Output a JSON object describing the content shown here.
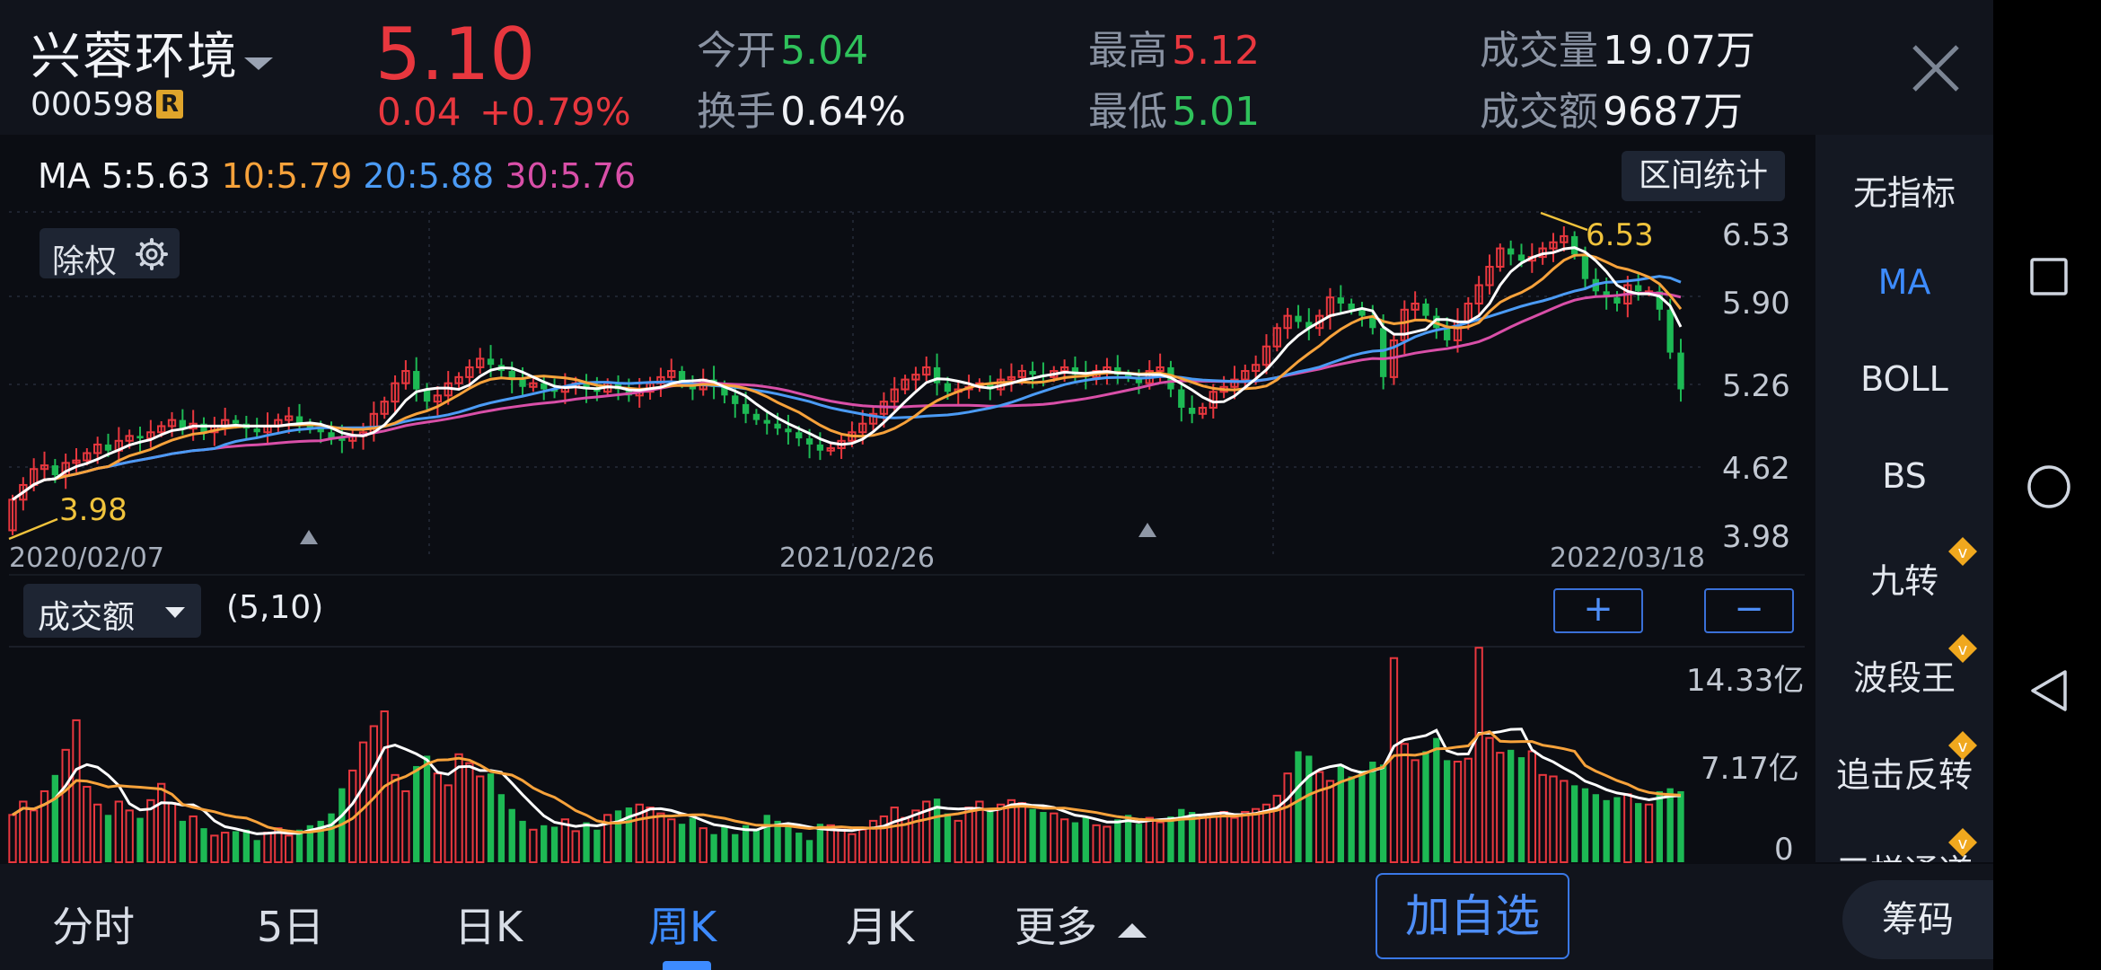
{
  "stock": {
    "name": "兴蓉环境",
    "code": "000598",
    "badge": "R",
    "price": "5.10",
    "change": "0.04",
    "change_pct": "+0.79%"
  },
  "quote": {
    "open": {
      "label": "今开",
      "value": "5.04"
    },
    "turnover": {
      "label": "换手",
      "value": "0.64%"
    },
    "high": {
      "label": "最高",
      "value": "5.12"
    },
    "low": {
      "label": "最低",
      "value": "5.01"
    },
    "volume": {
      "label": "成交量",
      "value": "19.07万"
    },
    "amount": {
      "label": "成交额",
      "value": "9687万"
    }
  },
  "ma_legend": {
    "title": "MA",
    "ma5": "5:5.63",
    "ma10": "10:5.79",
    "ma20": "20:5.88",
    "ma30": "30:5.76"
  },
  "toolbar": {
    "range_stats": "区间统计",
    "fq_label": "除权",
    "vol_select": "成交额",
    "vol_params": "(5,10)",
    "plus": "+",
    "minus": "−"
  },
  "side_menu": [
    {
      "label": "无指标",
      "active": false,
      "vip": false
    },
    {
      "label": "MA",
      "active": true,
      "vip": false
    },
    {
      "label": "BOLL",
      "active": false,
      "vip": false
    },
    {
      "label": "BS",
      "active": false,
      "vip": false
    },
    {
      "label": "九转",
      "active": false,
      "vip": true
    },
    {
      "label": "波段王",
      "active": false,
      "vip": true
    },
    {
      "label": "追击反转",
      "active": false,
      "vip": true
    },
    {
      "label": "三梯通道",
      "active": false,
      "vip": true
    }
  ],
  "bottom_tabs": [
    {
      "label": "分时",
      "active": false
    },
    {
      "label": "5日",
      "active": false
    },
    {
      "label": "日K",
      "active": false
    },
    {
      "label": "周K",
      "active": true
    },
    {
      "label": "月K",
      "active": false
    },
    {
      "label": "更多",
      "active": false
    }
  ],
  "actions": {
    "add_watchlist": "加自选",
    "chips": "筹码"
  },
  "colors": {
    "up": "#e8373e",
    "down": "#1db954",
    "ma5": "#ffffff",
    "ma10": "#f7a23b",
    "ma20": "#4b9bf5",
    "ma30": "#d94fa8",
    "accent": "#3d8bff"
  },
  "chart_data": {
    "type": "candlestick",
    "period": "weekly",
    "x_labels": [
      "2020/02/07",
      "2021/02/26",
      "2022/03/18"
    ],
    "price_axis_ticks": [
      "6.53",
      "5.90",
      "5.26",
      "4.62",
      "3.98"
    ],
    "ylim": [
      3.98,
      6.53
    ],
    "annotations": {
      "max": "6.53",
      "min": "3.98"
    },
    "close_series": [
      4.3,
      4.42,
      4.55,
      4.58,
      4.5,
      4.6,
      4.62,
      4.68,
      4.75,
      4.7,
      4.78,
      4.82,
      4.8,
      4.85,
      4.9,
      4.95,
      4.88,
      4.92,
      4.85,
      4.9,
      4.95,
      4.92,
      4.88,
      4.85,
      4.9,
      4.95,
      4.98,
      4.92,
      4.88,
      4.85,
      4.8,
      4.78,
      4.82,
      4.85,
      5.0,
      5.1,
      5.25,
      5.35,
      5.2,
      5.1,
      5.15,
      5.25,
      5.3,
      5.38,
      5.45,
      5.4,
      5.35,
      5.28,
      5.22,
      5.25,
      5.2,
      5.18,
      5.22,
      5.25,
      5.2,
      5.18,
      5.25,
      5.2,
      5.15,
      5.18,
      5.25,
      5.3,
      5.35,
      5.25,
      5.2,
      5.28,
      5.22,
      5.15,
      5.08,
      5.0,
      4.95,
      4.92,
      4.88,
      4.85,
      4.8,
      4.75,
      4.7,
      4.72,
      4.78,
      4.85,
      4.92,
      5.0,
      5.1,
      5.2,
      5.28,
      5.32,
      5.38,
      5.25,
      5.18,
      5.2,
      5.22,
      5.25,
      5.2,
      5.28,
      5.3,
      5.35,
      5.32,
      5.3,
      5.35,
      5.38,
      5.32,
      5.3,
      5.35,
      5.38,
      5.32,
      5.3,
      5.25,
      5.35,
      5.38,
      5.2,
      5.05,
      5.0,
      5.05,
      5.18,
      5.22,
      5.28,
      5.35,
      5.4,
      5.55,
      5.7,
      5.8,
      5.75,
      5.7,
      5.8,
      5.95,
      5.9,
      5.85,
      5.8,
      5.7,
      5.3,
      5.6,
      5.85,
      5.9,
      5.8,
      5.7,
      5.6,
      5.75,
      5.9,
      6.05,
      6.2,
      6.35,
      6.3,
      6.25,
      6.28,
      6.35,
      6.4,
      6.45,
      6.3,
      6.1,
      6.0,
      5.95,
      5.9,
      6.05,
      6.0,
      6.0,
      5.85,
      5.5,
      5.2
    ],
    "volume_axis_ticks": [
      "14.33亿",
      "7.17亿",
      "0"
    ],
    "volume_ylim": [
      0,
      14.33
    ],
    "volume_unit": "亿",
    "volume_series": [
      3.2,
      4.1,
      3.5,
      4.8,
      5.9,
      7.6,
      9.6,
      5.1,
      3.9,
      3.2,
      4.1,
      3.5,
      3.0,
      4.2,
      5.3,
      4.0,
      2.8,
      3.1,
      2.3,
      1.8,
      2.0,
      2.1,
      2.2,
      1.5,
      2.0,
      2.3,
      1.8,
      2.2,
      2.5,
      2.8,
      3.3,
      5.0,
      6.2,
      8.1,
      9.2,
      10.2,
      5.9,
      4.8,
      6.5,
      7.2,
      6.0,
      5.2,
      7.3,
      6.7,
      5.8,
      6.0,
      4.6,
      3.6,
      2.8,
      2.2,
      2.5,
      2.4,
      2.9,
      2.1,
      2.7,
      2.2,
      3.2,
      3.5,
      3.7,
      3.9,
      3.7,
      3.3,
      2.9,
      2.6,
      3.0,
      2.3,
      1.9,
      2.4,
      1.9,
      2.5,
      2.2,
      3.2,
      2.8,
      2.4,
      2.0,
      1.5,
      2.6,
      2.5,
      2.2,
      1.9,
      2.2,
      2.8,
      3.1,
      3.7,
      3.0,
      3.5,
      4.1,
      4.3,
      3.3,
      2.8,
      3.7,
      4.1,
      3.5,
      3.9,
      4.2,
      4.0,
      3.6,
      3.4,
      3.3,
      2.9,
      2.7,
      3.1,
      2.5,
      2.4,
      2.9,
      3.2,
      2.6,
      3.0,
      2.7,
      3.1,
      3.6,
      3.4,
      3.2,
      3.1,
      3.4,
      3.0,
      3.4,
      3.6,
      3.9,
      4.5,
      6.0,
      7.5,
      7.2,
      6.1,
      5.5,
      6.6,
      5.8,
      6.2,
      6.8,
      6.6,
      13.8,
      8.0,
      6.9,
      7.5,
      8.4,
      6.9,
      6.8,
      7.0,
      14.5,
      8.4,
      7.4,
      7.6,
      7.1,
      7.5,
      5.9,
      5.8,
      5.5,
      5.2,
      5.0,
      4.6,
      4.2,
      4.4,
      4.6,
      4.0,
      3.9,
      4.8,
      5.0,
      4.8
    ]
  }
}
